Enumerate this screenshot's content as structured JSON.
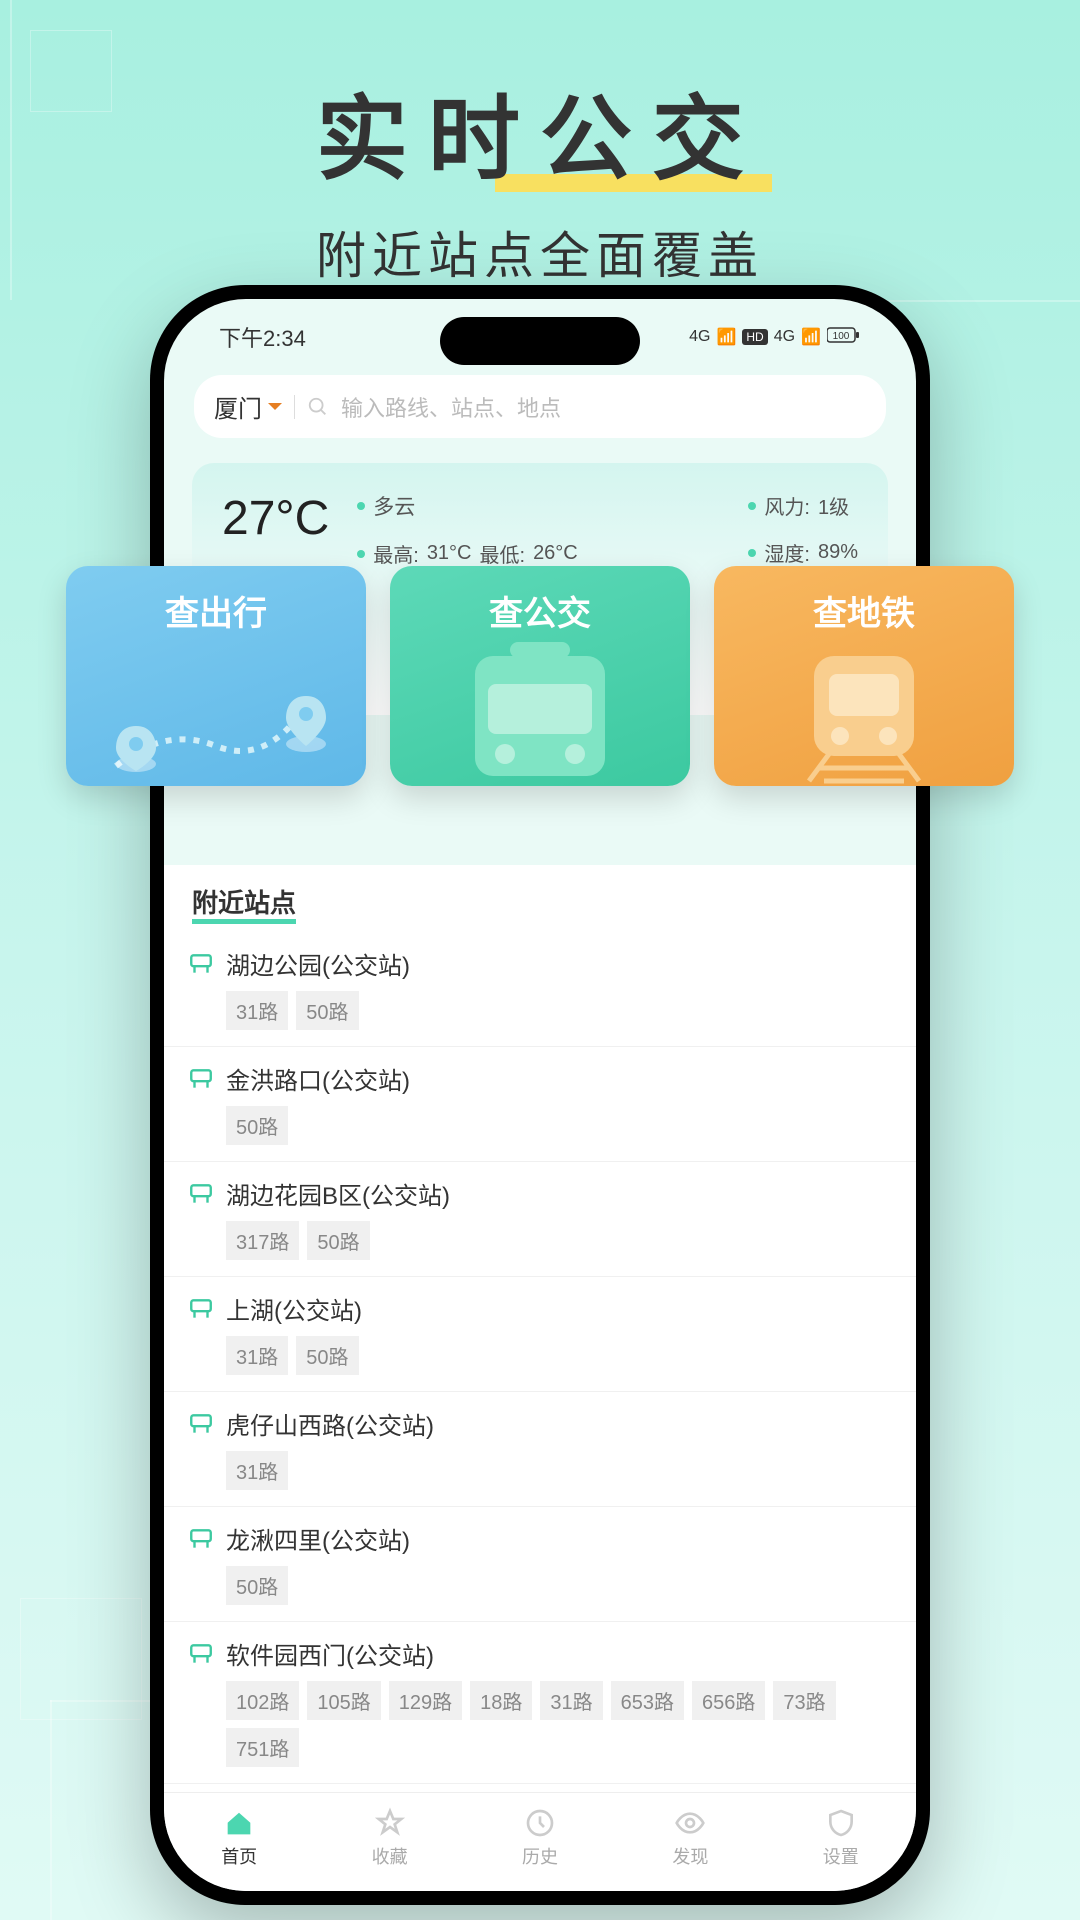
{
  "promo": {
    "title": "实时公交",
    "subtitle": "附近站点全面覆盖"
  },
  "status_bar": {
    "time": "下午2:34",
    "network1": "4G",
    "hd_badge": "HD",
    "network2": "4G",
    "battery": "100"
  },
  "search": {
    "city": "厦门",
    "placeholder": "输入路线、站点、地点"
  },
  "weather": {
    "temp": "27°C",
    "condition": "多云",
    "high_label": "最高:",
    "high": "31°C",
    "low_label": "最低:",
    "low": "26°C",
    "wind_label": "风力:",
    "wind": "1级",
    "humidity_label": "湿度:",
    "humidity": "89%"
  },
  "action_cards": [
    {
      "label": "查出行"
    },
    {
      "label": "查公交"
    },
    {
      "label": "查地铁"
    }
  ],
  "nearby": {
    "header": "附近站点",
    "stops": [
      {
        "name": "湖边公园(公交站)",
        "routes": [
          "31路",
          "50路"
        ]
      },
      {
        "name": "金洪路口(公交站)",
        "routes": [
          "50路"
        ]
      },
      {
        "name": "湖边花园B区(公交站)",
        "routes": [
          "317路",
          "50路"
        ]
      },
      {
        "name": "上湖(公交站)",
        "routes": [
          "31路",
          "50路"
        ]
      },
      {
        "name": "虎仔山西路(公交站)",
        "routes": [
          "31路"
        ]
      },
      {
        "name": "龙湫四里(公交站)",
        "routes": [
          "50路"
        ]
      },
      {
        "name": "软件园西门(公交站)",
        "routes": [
          "102路",
          "105路",
          "129路",
          "18路",
          "31路",
          "653路",
          "656路",
          "73路",
          "751路"
        ]
      }
    ]
  },
  "bottom_nav": [
    {
      "label": "首页",
      "active": true
    },
    {
      "label": "收藏",
      "active": false
    },
    {
      "label": "历史",
      "active": false
    },
    {
      "label": "发现",
      "active": false
    },
    {
      "label": "设置",
      "active": false
    }
  ]
}
